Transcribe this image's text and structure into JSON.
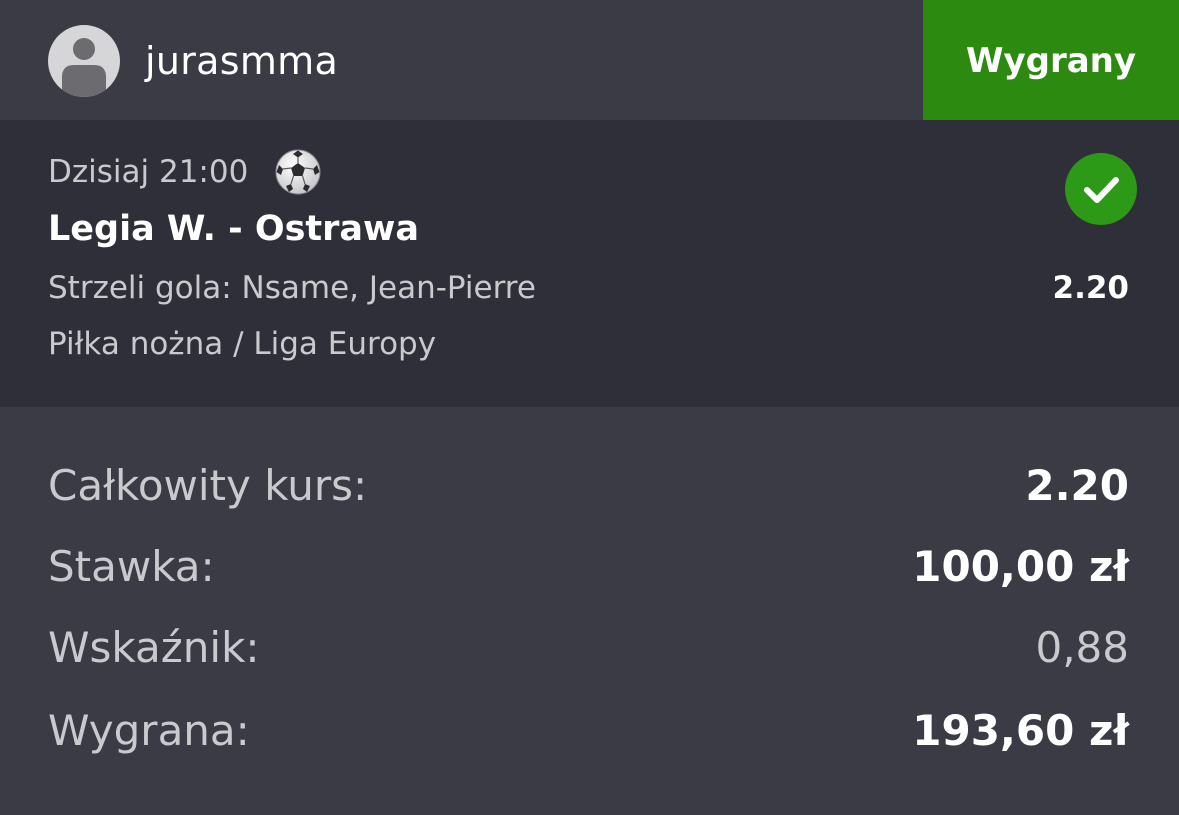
{
  "header": {
    "username": "jurasmma",
    "status_label": "Wygrany",
    "status_color": "#2d8a10",
    "avatar_icon": "user-avatar-icon"
  },
  "event": {
    "time": "Dzisiaj 21:00",
    "sport_icon": "soccer-ball-icon",
    "status_icon": "checkmark-icon",
    "match": "Legia W. - Ostrawa",
    "selection": "Strzeli gola: Nsame, Jean-Pierre",
    "odds": "2.20",
    "league": "Piłka nożna / Liga Europy"
  },
  "summary": {
    "total_odds_label": "Całkowity kurs:",
    "total_odds_value": "2.20",
    "stake_label": "Stawka:",
    "stake_value": "100,00 zł",
    "ratio_label": "Wskaźnik:",
    "ratio_value": "0,88",
    "winnings_label": "Wygrana:",
    "winnings_value": "193,60 zł"
  },
  "colors": {
    "background": "#3a3b45",
    "card": "#2e2f38",
    "win_green": "#2d8a10",
    "check_green": "#2d9a17"
  }
}
